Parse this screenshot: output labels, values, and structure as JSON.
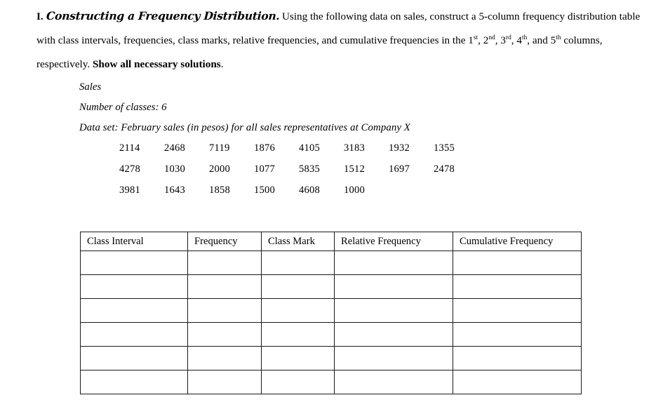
{
  "document": {
    "problem": {
      "numeral": "I.",
      "title": "Constructing a Frequency Distribution.",
      "body_part_1": "Using the following data on sales, construct a 5-column frequency distribution table with class intervals, frequencies, class marks, relative frequencies, and cumulative frequencies in the ",
      "ordinals": [
        "1",
        "2",
        "3",
        "4",
        "5"
      ],
      "ordinal_suffixes": [
        "st",
        "nd",
        "rd",
        "th",
        "th"
      ],
      "body_part_2": " columns, respectively. ",
      "emphasis": "Show all necessary solutions",
      "body_part_3": "."
    },
    "meta": {
      "sales_label": "Sales",
      "number_of_classes_label": "Number of classes:",
      "number_of_classes_value": "6",
      "data_set_label": "Data set:",
      "data_set_description": "February sales (in pesos) for all sales representatives at Company X"
    },
    "data_set": {
      "rows": [
        [
          "2114",
          "2468",
          "7119",
          "1876",
          "4105",
          "3183",
          "1932",
          "1355"
        ],
        [
          "4278",
          "1030",
          "2000",
          "1077",
          "5835",
          "1512",
          "1697",
          "2478"
        ],
        [
          "3981",
          "1643",
          "1858",
          "1500",
          "4608",
          "1000"
        ]
      ]
    },
    "table": {
      "headers": [
        "Class Interval",
        "Frequency",
        "Class Mark",
        "Relative Frequency",
        "Cumulative Frequency"
      ],
      "body_rows": [
        [
          "",
          "",
          "",
          "",
          ""
        ],
        [
          "",
          "",
          "",
          "",
          ""
        ],
        [
          "",
          "",
          "",
          "",
          ""
        ],
        [
          "",
          "",
          "",
          "",
          ""
        ],
        [
          "",
          "",
          "",
          "",
          ""
        ],
        [
          "",
          "",
          "",
          "",
          ""
        ]
      ]
    }
  }
}
